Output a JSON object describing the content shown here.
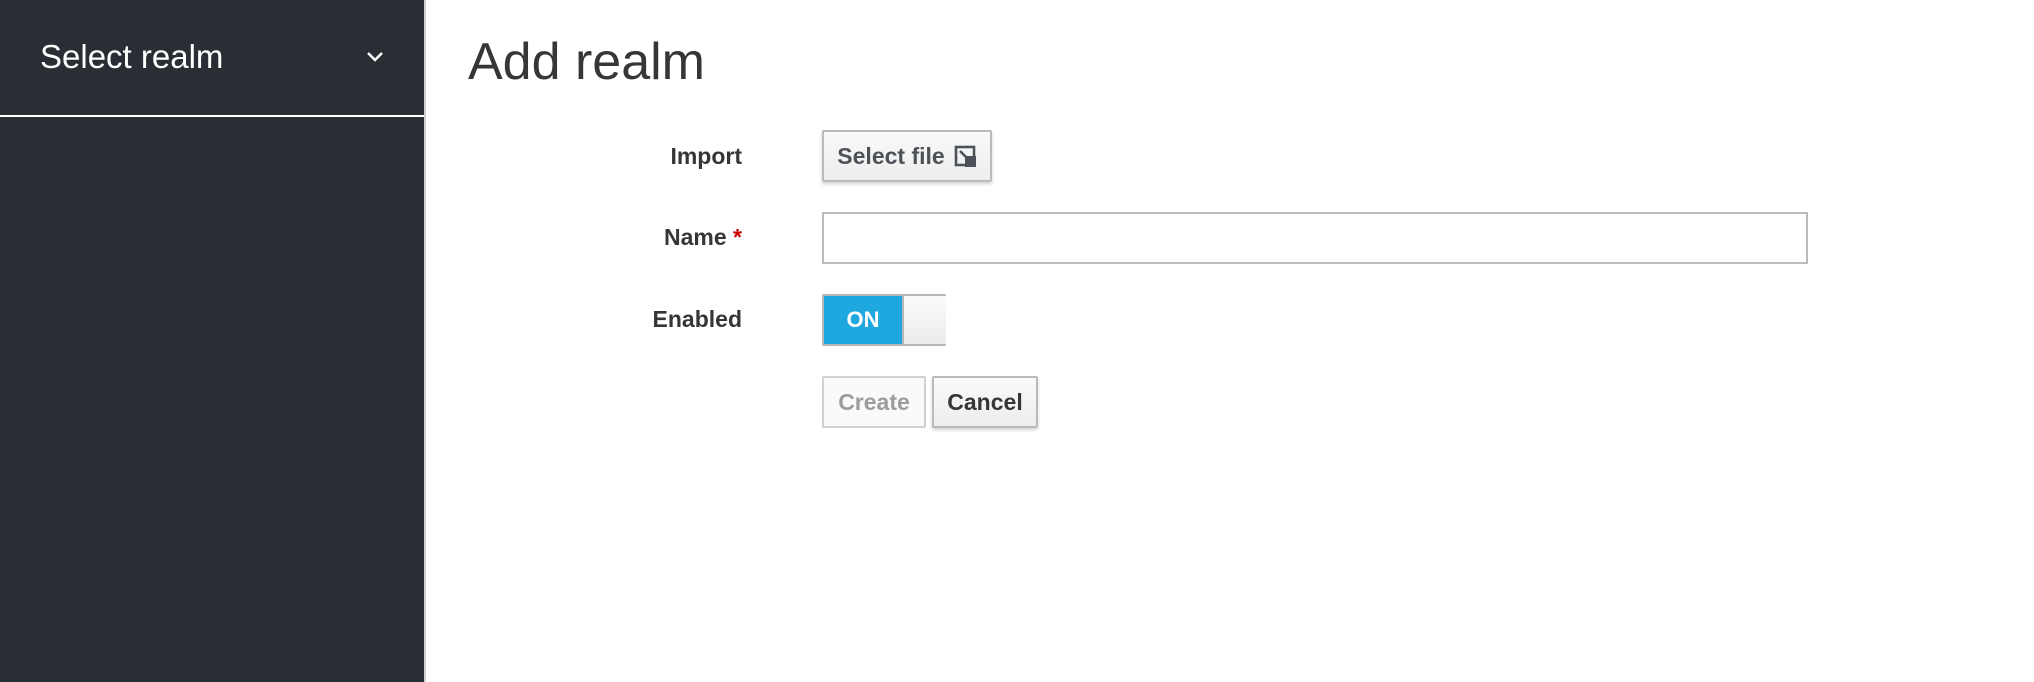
{
  "sidebar": {
    "realm_selector_label": "Select realm"
  },
  "main": {
    "title": "Add realm",
    "form": {
      "import_label": "Import",
      "select_file_label": "Select file",
      "name_label": "Name",
      "name_required_marker": "*",
      "name_value": "",
      "enabled_label": "Enabled",
      "enabled_toggle_text": "ON",
      "create_label": "Create",
      "cancel_label": "Cancel"
    }
  },
  "colors": {
    "sidebar_bg": "#292e34",
    "toggle_on": "#1fa8df",
    "required": "#cc0000"
  },
  "icons": [
    "chevron-down-icon",
    "import-file-icon"
  ]
}
